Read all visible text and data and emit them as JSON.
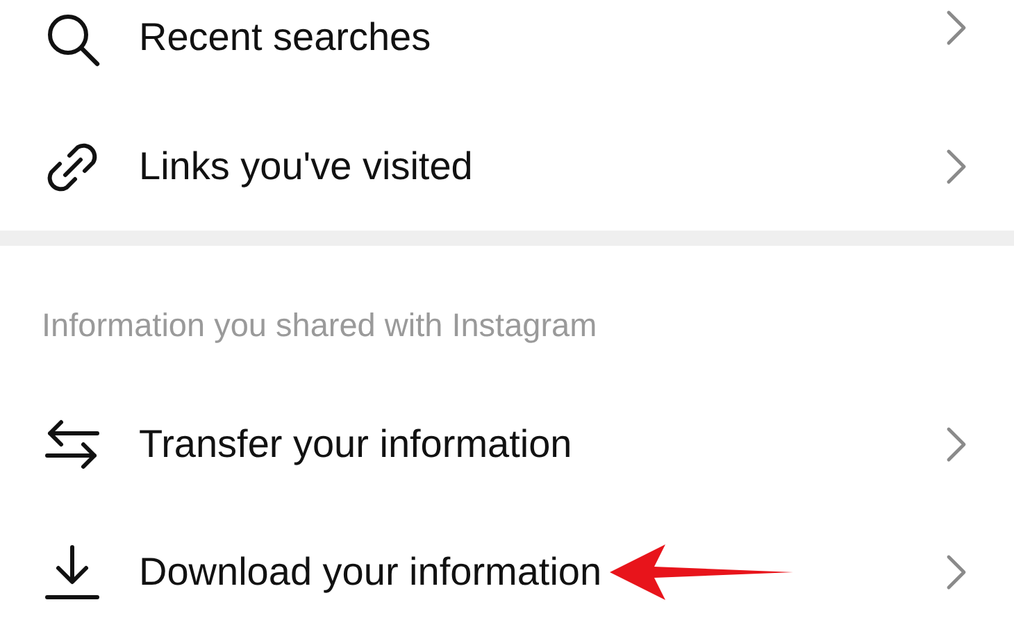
{
  "sections": [
    {
      "items": [
        {
          "label": "Recent searches",
          "kind": "search",
          "highlighted": false
        },
        {
          "label": "Links you've visited",
          "kind": "link",
          "highlighted": false
        }
      ]
    },
    {
      "header": "Information you shared with Instagram",
      "items": [
        {
          "label": "Transfer your information",
          "kind": "transfer",
          "highlighted": false
        },
        {
          "label": "Download your information",
          "kind": "download",
          "highlighted": true
        }
      ]
    }
  ]
}
